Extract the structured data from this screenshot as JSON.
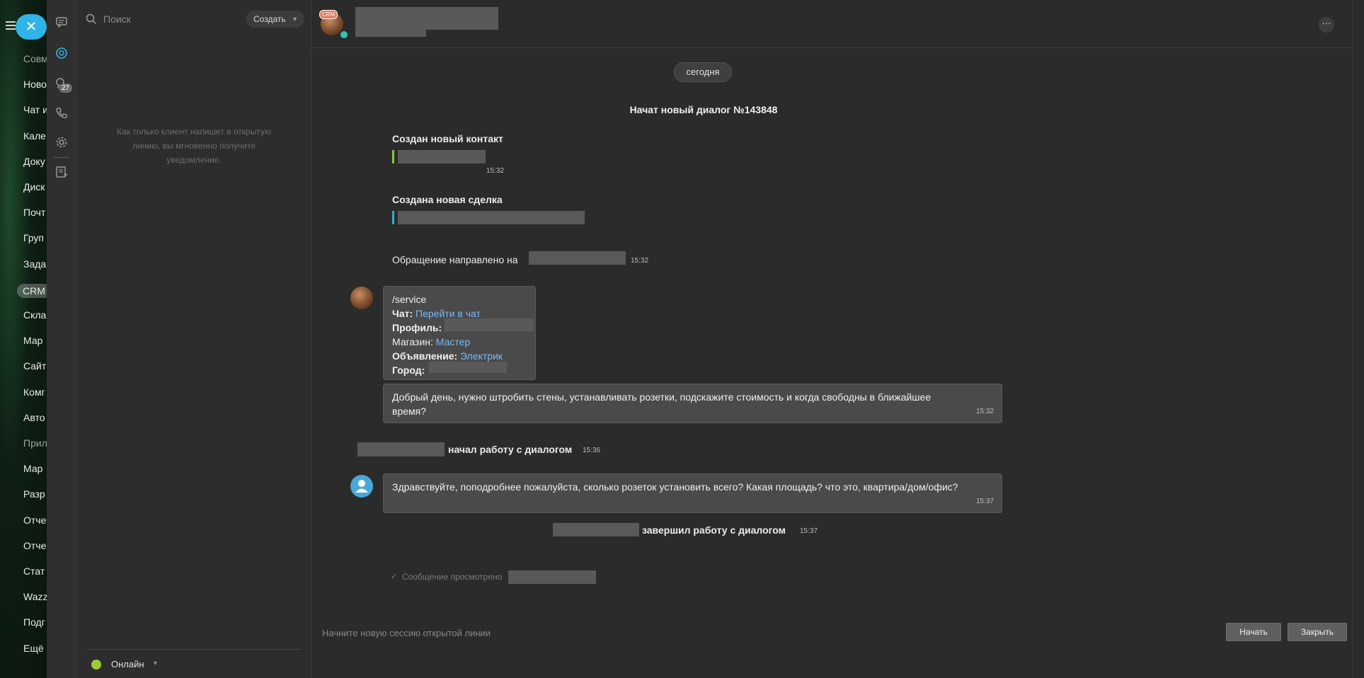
{
  "left_nav": {
    "items": [
      {
        "label": "Совм",
        "dim": true
      },
      {
        "label": "Ново"
      },
      {
        "label": "Чат и"
      },
      {
        "label": "Кале"
      },
      {
        "label": "Доку"
      },
      {
        "label": "Диск"
      },
      {
        "label": "Почт"
      },
      {
        "label": "Груп"
      },
      {
        "label": "Зада"
      },
      {
        "label": "CRM",
        "selected": true
      },
      {
        "label": "Скла"
      },
      {
        "label": "Мар"
      },
      {
        "label": "Сайт"
      },
      {
        "label": "Комг"
      },
      {
        "label": "Авто"
      },
      {
        "label": "Прил",
        "dim": true
      },
      {
        "label": "Мар"
      },
      {
        "label": "Разр"
      },
      {
        "label": "Отче"
      },
      {
        "label": "Отче"
      },
      {
        "label": "Стат"
      },
      {
        "label": "Wazz"
      },
      {
        "label": "Подг"
      },
      {
        "label": "Ещё"
      }
    ],
    "close_symbol": "✕"
  },
  "icon_column": {
    "icons": [
      "chat-icon",
      "openlines-icon",
      "notifications-icon",
      "phone-icon",
      "settings-icon",
      "tasks-icon"
    ],
    "badge_count": "27"
  },
  "list_panel": {
    "search_placeholder": "Поиск",
    "create_label": "Создать",
    "empty_hint": "Как только клиент напишет в открытую линию, вы мгновенно получите уведомление.",
    "status_label": "Онлайн",
    "status_color": "#9bcc33"
  },
  "header": {
    "crm_badge": "CRM",
    "more_symbol": "···"
  },
  "chat": {
    "date_label": "сегодня",
    "dialog_started": "Начат новый диалог №143848",
    "contact_created": "Создан новый контакт",
    "contact_time": "15:32",
    "deal_created": "Создана новая сделка",
    "forwarded_label": "Обращение направлено на",
    "forwarded_time": "15:32",
    "info_bubble": {
      "line1": "/service",
      "chat_key": "Чат:",
      "chat_link": "Перейти в чат",
      "profile_key": "Профиль:",
      "shop_key": "Магазин:",
      "shop_link": "Мастер",
      "ad_key": "Объявление:",
      "ad_link": "Электрик",
      "city_key": "Город:"
    },
    "client_message": {
      "text": "Добрый день, нужно штробить стены, устанавливать розетки, подскажите стоимость и когда свободны в ближайшее время?",
      "time": "15:32"
    },
    "operator_started": "начал работу с диалогом",
    "operator_started_time": "15:36",
    "operator_message": {
      "text": "Здравствуйте, поподробнее пожалуйста, сколько розеток установить всего? Какая площадь? что это, квартира/дом/офис?",
      "time": "15:37"
    },
    "operator_finished": "завершил работу с диалогом",
    "operator_finished_time": "15:37",
    "read_receipt": "Сообщение просмотрено"
  },
  "footer": {
    "hint": "Начните новую сессию открытой линии",
    "start_label": "Начать",
    "close_label": "Закрыть"
  }
}
